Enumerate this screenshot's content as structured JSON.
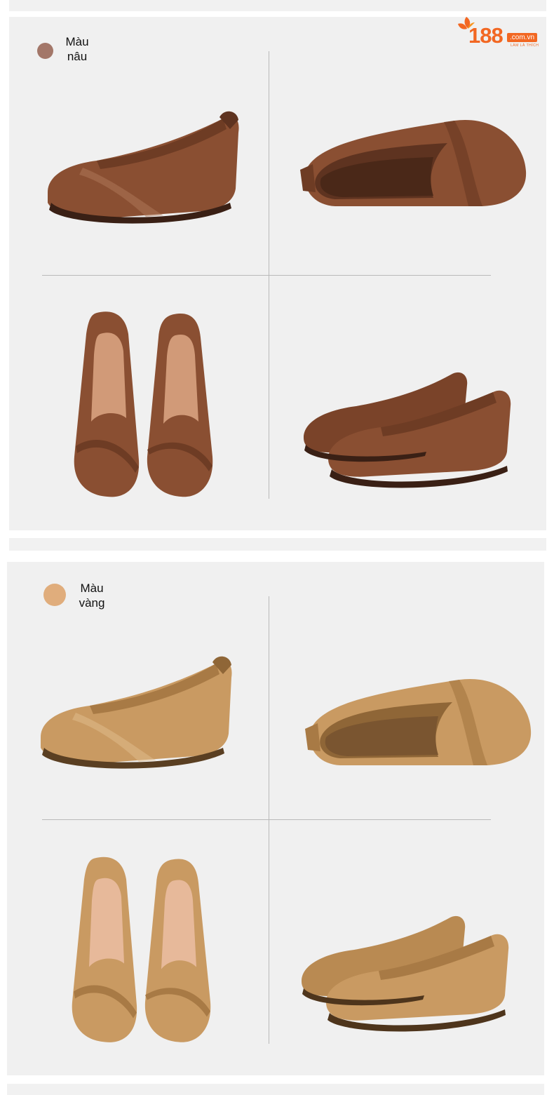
{
  "logo": {
    "number": "188",
    "tld": ".com.vn",
    "slogan": "LÀM LÀ THÍCH"
  },
  "sections": [
    {
      "label_line1": "Màu",
      "label_line2": "nâu",
      "swatch_color": "#a37769",
      "shoe_color": "#8a4f32",
      "shoe_dark": "#5e3320",
      "shoe_light": "#b0795a"
    },
    {
      "label_line1": "Màu",
      "label_line2": "vàng",
      "swatch_color": "#e0ad7c",
      "shoe_color": "#c99a62",
      "shoe_dark": "#8f6637",
      "shoe_light": "#e2bd8d"
    }
  ]
}
